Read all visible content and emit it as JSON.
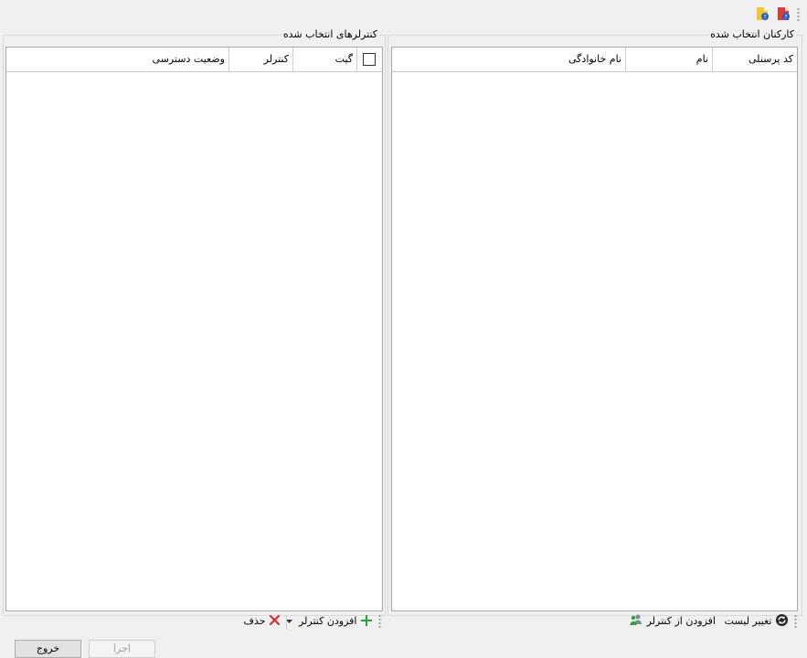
{
  "toolbar": {
    "icons": [
      "help-pdf-icon",
      "help-doc-icon"
    ]
  },
  "personnel_panel": {
    "title": "کارکنان انتخاب شده",
    "columns": [
      "کد پرسنلی",
      "نام",
      "نام خانوادگی"
    ],
    "actions": {
      "refresh_label": "تغییر لیست",
      "add_from_controller_label": "افزودن از کنترلر"
    }
  },
  "controllers_panel": {
    "title": "کنترلرهای انتخاب شده",
    "columns": [
      "گیت",
      "کنترلر",
      "وضعیت دسترسی"
    ],
    "actions": {
      "add_controller_label": "افزودن کنترلر",
      "delete_label": "حذف"
    }
  },
  "footer": {
    "execute_label": "اجرا",
    "exit_label": "خروج"
  },
  "colors": {
    "background": "#f0f0f0",
    "grid_border": "#a8a8a8",
    "add_green": "#2e9e3a",
    "delete_red": "#d32f2f"
  }
}
